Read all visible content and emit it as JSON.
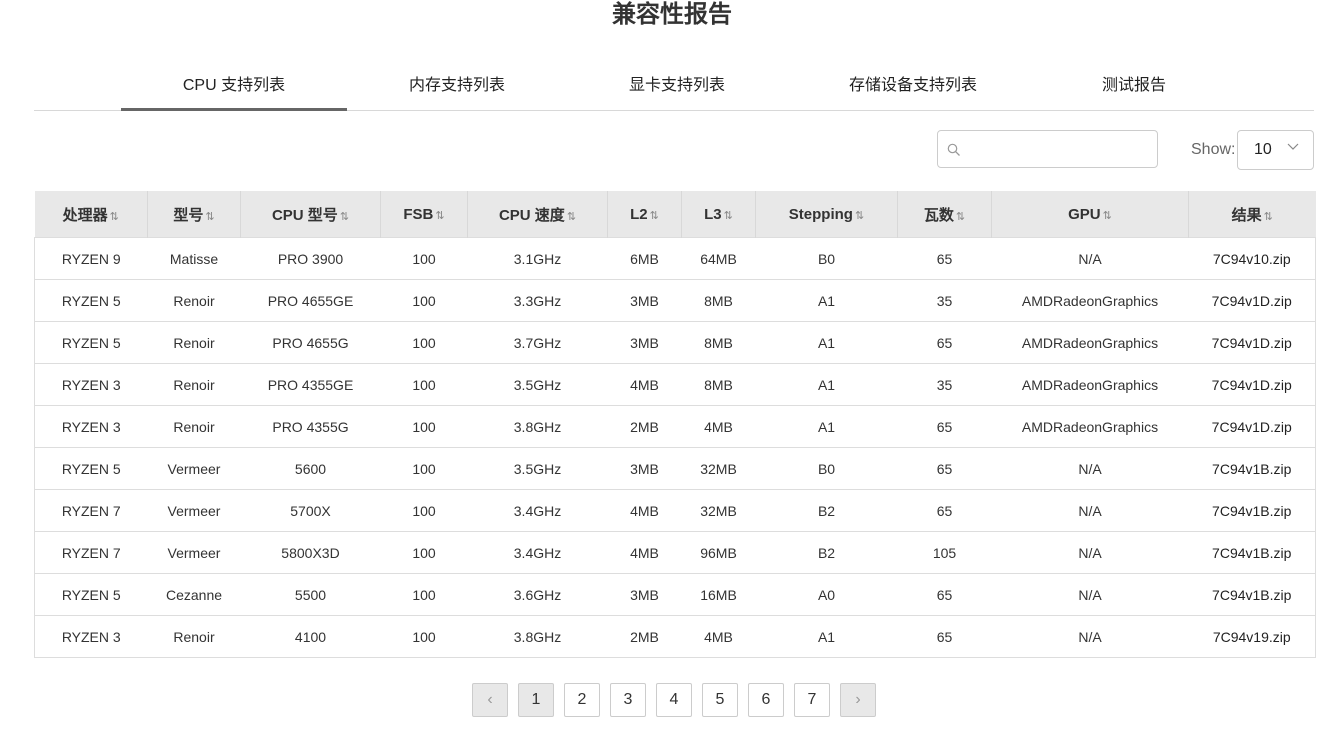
{
  "page": {
    "title": "兼容性报告"
  },
  "tabs": [
    {
      "label": "CPU 支持列表",
      "active": true
    },
    {
      "label": "内存支持列表",
      "active": false
    },
    {
      "label": "显卡支持列表",
      "active": false
    },
    {
      "label": "存储设备支持列表",
      "active": false
    },
    {
      "label": "测试报告",
      "active": false
    }
  ],
  "search": {
    "value": "",
    "placeholder": ""
  },
  "show": {
    "label": "Show:",
    "value": "10"
  },
  "table": {
    "sort_glyph": "⇅",
    "columns": [
      "处理器",
      "型号",
      "CPU 型号",
      "FSB",
      "CPU 速度",
      "L2",
      "L3",
      "Stepping",
      "瓦数",
      "GPU",
      "结果"
    ],
    "rows": [
      [
        "RYZEN 9",
        "Matisse",
        "PRO 3900",
        "100",
        "3.1GHz",
        "6MB",
        "64MB",
        "B0",
        "65",
        "N/A",
        "7C94v10.zip"
      ],
      [
        "RYZEN 5",
        "Renoir",
        "PRO 4655GE",
        "100",
        "3.3GHz",
        "3MB",
        "8MB",
        "A1",
        "35",
        "AMDRadeonGraphics",
        "7C94v1D.zip"
      ],
      [
        "RYZEN 5",
        "Renoir",
        "PRO 4655G",
        "100",
        "3.7GHz",
        "3MB",
        "8MB",
        "A1",
        "65",
        "AMDRadeonGraphics",
        "7C94v1D.zip"
      ],
      [
        "RYZEN 3",
        "Renoir",
        "PRO 4355GE",
        "100",
        "3.5GHz",
        "4MB",
        "8MB",
        "A1",
        "35",
        "AMDRadeonGraphics",
        "7C94v1D.zip"
      ],
      [
        "RYZEN 3",
        "Renoir",
        "PRO 4355G",
        "100",
        "3.8GHz",
        "2MB",
        "4MB",
        "A1",
        "65",
        "AMDRadeonGraphics",
        "7C94v1D.zip"
      ],
      [
        "RYZEN 5",
        "Vermeer",
        "5600",
        "100",
        "3.5GHz",
        "3MB",
        "32MB",
        "B0",
        "65",
        "N/A",
        "7C94v1B.zip"
      ],
      [
        "RYZEN 7",
        "Vermeer",
        "5700X",
        "100",
        "3.4GHz",
        "4MB",
        "32MB",
        "B2",
        "65",
        "N/A",
        "7C94v1B.zip"
      ],
      [
        "RYZEN 7",
        "Vermeer",
        "5800X3D",
        "100",
        "3.4GHz",
        "4MB",
        "96MB",
        "B2",
        "105",
        "N/A",
        "7C94v1B.zip"
      ],
      [
        "RYZEN 5",
        "Cezanne",
        "5500",
        "100",
        "3.6GHz",
        "3MB",
        "16MB",
        "A0",
        "65",
        "N/A",
        "7C94v1B.zip"
      ],
      [
        "RYZEN 3",
        "Renoir",
        "4100",
        "100",
        "3.8GHz",
        "2MB",
        "4MB",
        "A1",
        "65",
        "N/A",
        "7C94v19.zip"
      ]
    ]
  },
  "pagination": {
    "prev": "‹",
    "next": "›",
    "pages": [
      "1",
      "2",
      "3",
      "4",
      "5",
      "6",
      "7"
    ],
    "current": "1"
  }
}
